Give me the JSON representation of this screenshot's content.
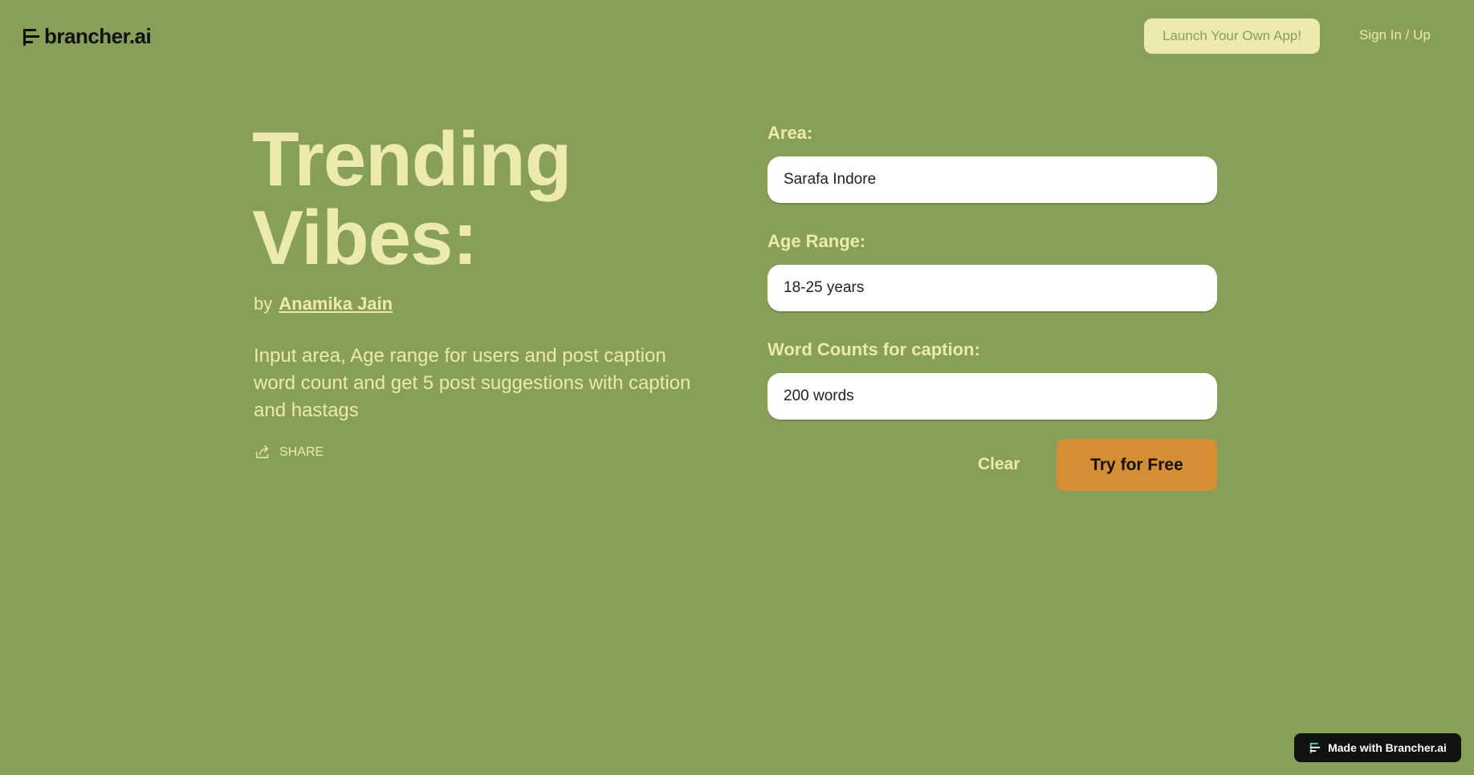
{
  "header": {
    "logo_text": "brancher.ai",
    "launch_label": "Launch Your Own App!",
    "signin_label": "Sign In / Up"
  },
  "app": {
    "title_line1": "Trending",
    "title_line2": "Vibes:",
    "by_prefix": "by",
    "author": "Anamika Jain",
    "description": "Input area, Age range for users and post caption word count and get 5 post suggestions with caption and hastags",
    "share_label": "SHARE"
  },
  "form": {
    "area": {
      "label": "Area:",
      "value": "Sarafa Indore"
    },
    "age": {
      "label": "Age Range:",
      "value": "18-25 years"
    },
    "words": {
      "label": "Word Counts for caption:",
      "value": "200 words"
    },
    "clear_label": "Clear",
    "submit_label": "Try for Free"
  },
  "footer": {
    "badge_label": "Made with Brancher.ai"
  },
  "colors": {
    "background": "#889f58",
    "accent_light": "#eceaae",
    "cta": "#d68e34"
  }
}
